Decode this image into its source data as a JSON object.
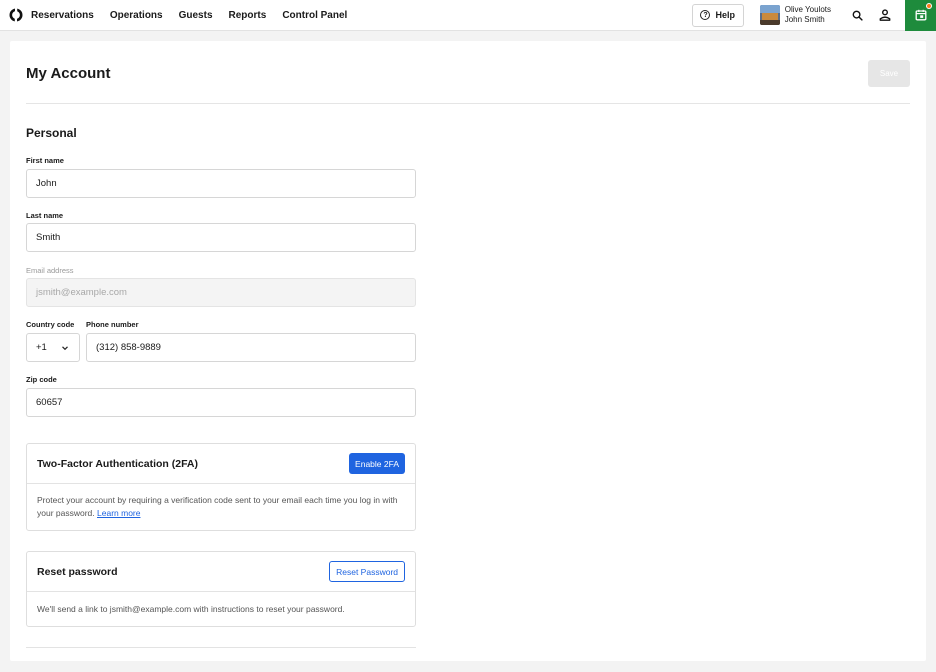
{
  "nav": {
    "items": [
      "Reservations",
      "Operations",
      "Guests",
      "Reports",
      "Control Panel"
    ],
    "help_label": "Help",
    "venue_name": "Olive Youlots",
    "user_name": "John Smith"
  },
  "page": {
    "title": "My Account",
    "save_label": "Save",
    "section_personal": "Personal"
  },
  "form": {
    "first_name_label": "First name",
    "first_name_value": "John",
    "last_name_label": "Last name",
    "last_name_value": "Smith",
    "email_label": "Email address",
    "email_value": "jsmith@example.com",
    "country_code_label": "Country code",
    "country_code_value": "+1",
    "phone_label": "Phone number",
    "phone_value": "(312) 858-9889",
    "zip_label": "Zip code",
    "zip_value": "60657"
  },
  "two_factor": {
    "title": "Two-Factor Authentication (2FA)",
    "button": "Enable 2FA",
    "description": "Protect your account by requiring a verification code sent to your email each time you log in with your password.",
    "link": "Learn more"
  },
  "reset": {
    "title": "Reset password",
    "button": "Reset Password",
    "description": "We'll send a link to jsmith@example.com with instructions to reset your password."
  },
  "colors": {
    "accent": "#1f64e0",
    "calendar_bg": "#1e8b3c",
    "notification": "#ff7a1a"
  }
}
